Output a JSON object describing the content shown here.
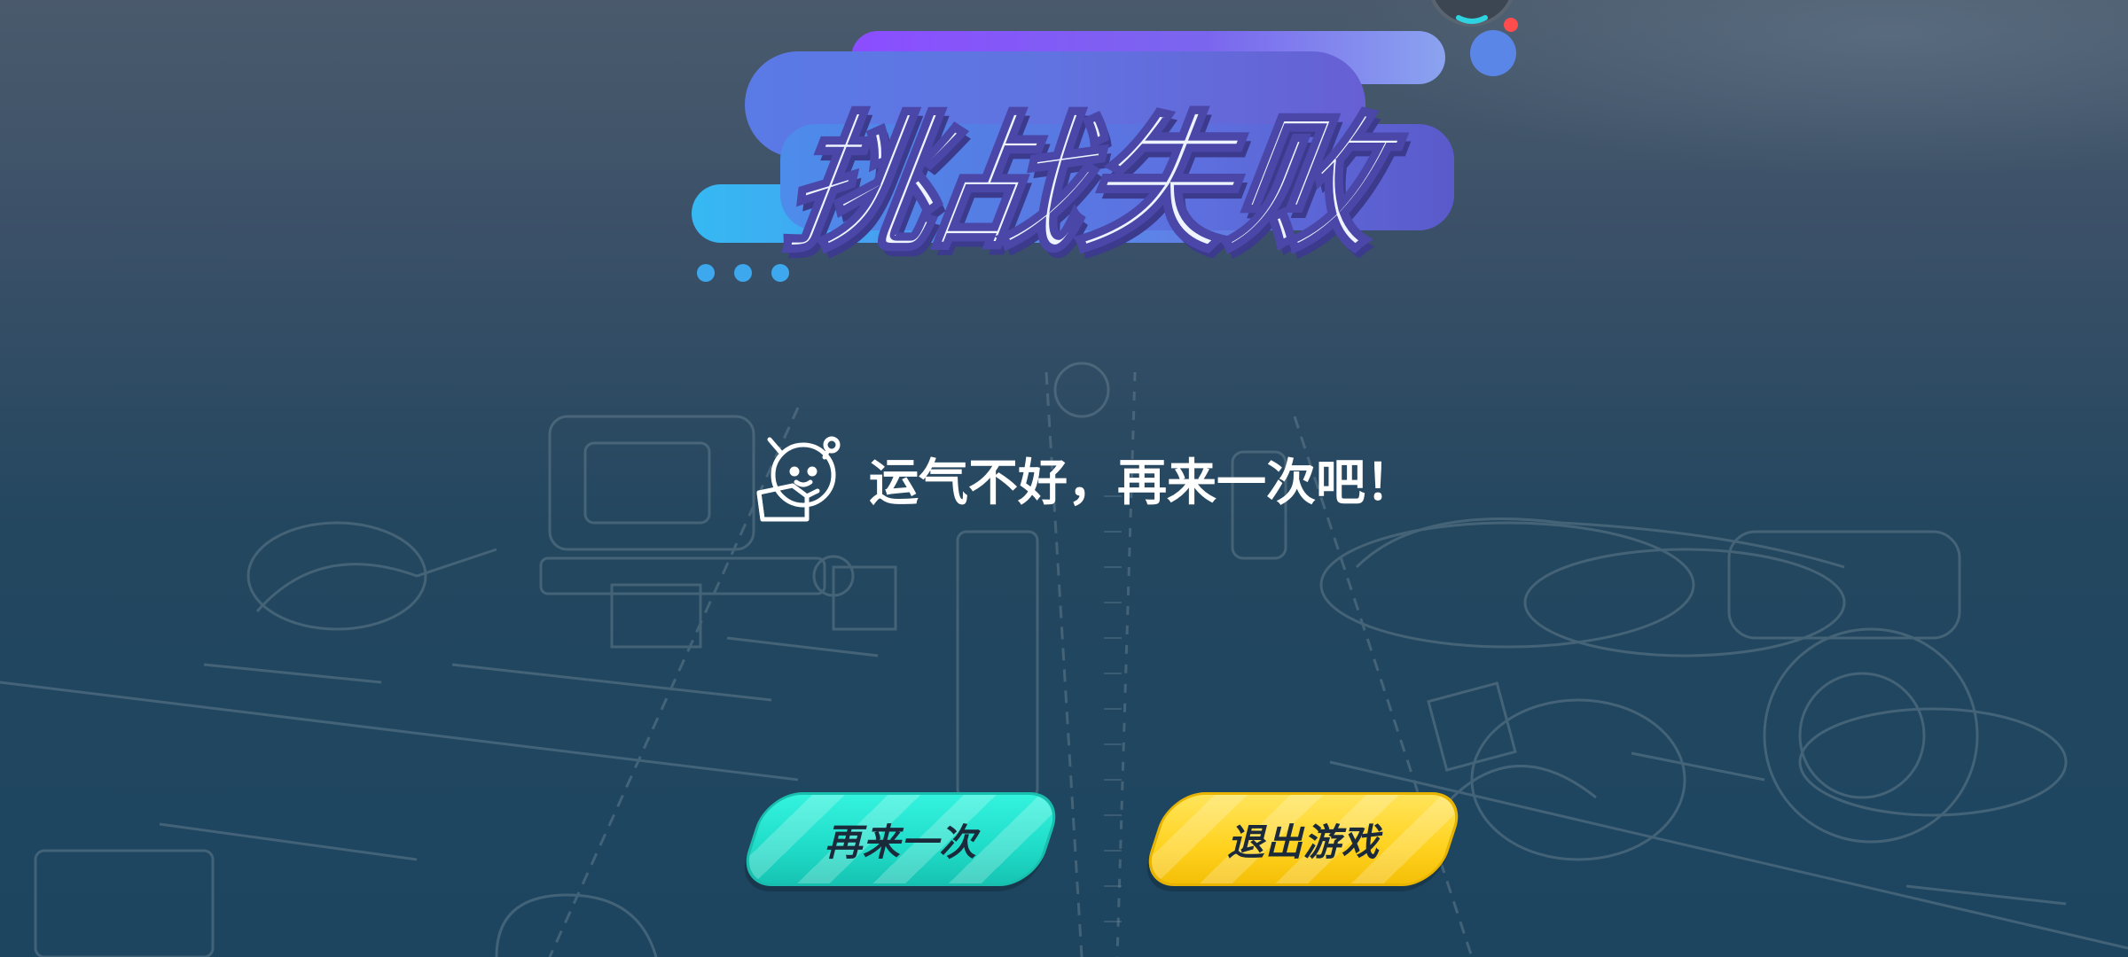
{
  "screen": {
    "title": "挑战失败",
    "message": "运气不好，再来一次吧！",
    "pager_dot_count": 3
  },
  "buttons": {
    "retry_label": "再来一次",
    "exit_label": "退出游戏"
  },
  "icons": {
    "mascot": "robot-mascot-icon",
    "top_mascot": "robot-head-icon"
  },
  "colors": {
    "background_top": "#4a5a6c",
    "background_bottom": "#1d4560",
    "title_fill": "#eef3ff",
    "title_outline": "#4a47a8",
    "retry_button": "#1fdcc8",
    "exit_button": "#ffd21f",
    "pager_dot": "#3ea8ef"
  }
}
